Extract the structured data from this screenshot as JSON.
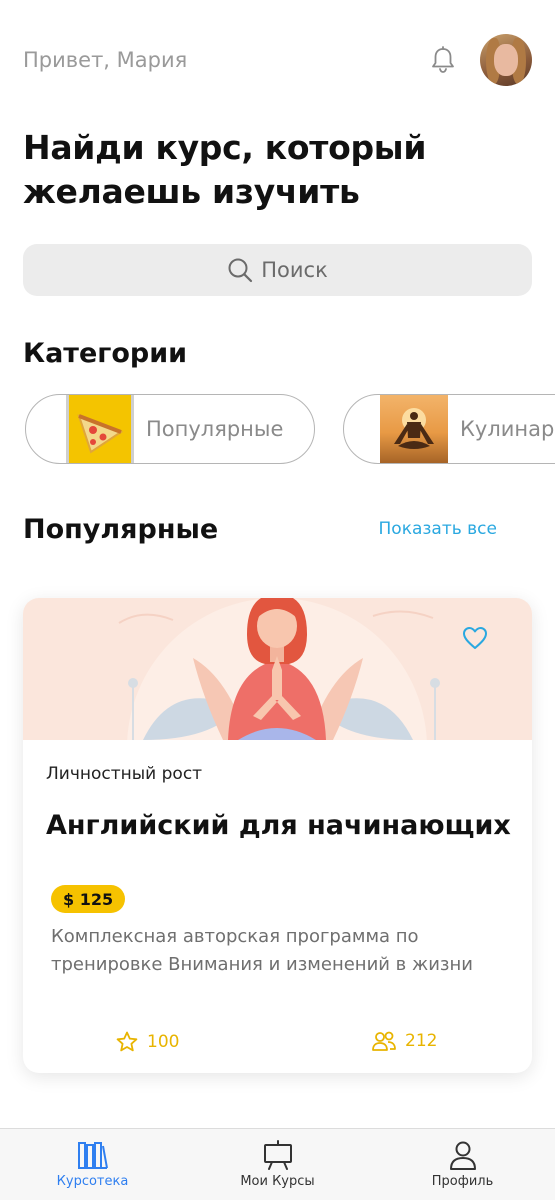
{
  "header": {
    "greeting": "Привет, Мария"
  },
  "title": "Найди курс, который желаешь изучить",
  "search": {
    "label": "Поиск"
  },
  "categories": {
    "title": "Категории",
    "items": [
      {
        "label": "Популярные"
      },
      {
        "label": "Кулинарн"
      }
    ]
  },
  "popular": {
    "title": "Популярные",
    "show_all": "Показать все"
  },
  "course": {
    "category": "Личностный рост",
    "title": "Английский для начинающих",
    "price": "$ 125",
    "description": "Комплексная авторская программа по тренировке Внимания и изменений в жизни",
    "rating": "100",
    "students": "212"
  },
  "tabbar": {
    "items": [
      {
        "label": "Курсотека",
        "icon": "books-icon",
        "active": true
      },
      {
        "label": "Мои Курсы",
        "icon": "presentation-board-icon",
        "active": false
      },
      {
        "label": "Профиль",
        "icon": "user-icon",
        "active": false
      }
    ]
  },
  "colors": {
    "accent_blue": "#2f7ff0",
    "link_blue": "#2aa8e0",
    "price_yellow": "#f6c200",
    "stat_yellow": "#e8b400",
    "search_bg": "#ececec"
  }
}
